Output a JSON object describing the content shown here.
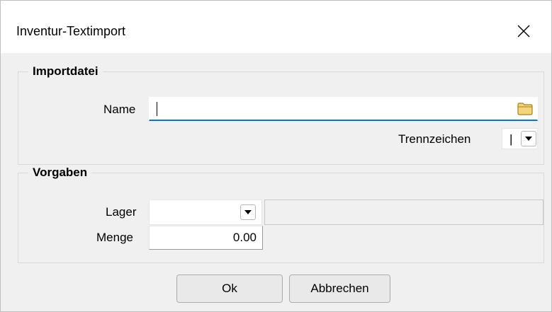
{
  "window": {
    "title": "Inventur-Textimport"
  },
  "import_group": {
    "title": "Importdatei",
    "name_label": "Name",
    "name_value": "",
    "separator_label": "Trennzeichen",
    "separator_value": "|"
  },
  "defaults_group": {
    "title": "Vorgaben",
    "lager_label": "Lager",
    "lager_value": "",
    "lager_description": "",
    "menge_label": "Menge",
    "menge_value": "0.00"
  },
  "buttons": {
    "ok_label": "Ok",
    "cancel_label": "Abbrechen"
  },
  "icons": {
    "close": "close-icon",
    "browse": "folder-icon",
    "dropdown": "chevron-down-icon"
  },
  "colors": {
    "accent": "#0078d7",
    "folder": "#e8c15a"
  }
}
